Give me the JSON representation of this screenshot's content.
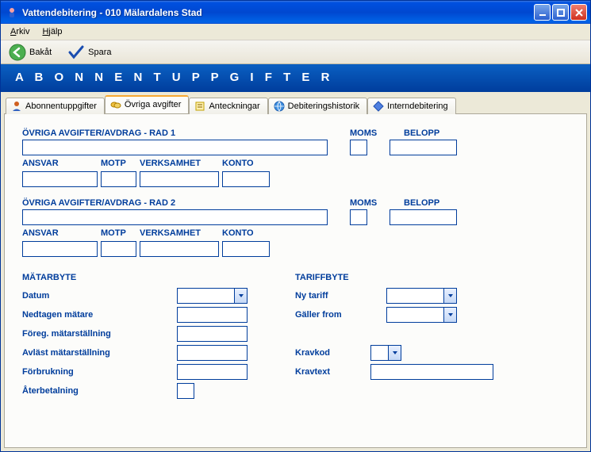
{
  "window": {
    "title": "Vattendebitering  -  010 Mälardalens Stad"
  },
  "menu": {
    "arkiv": "Arkiv",
    "arkiv_ul": "A",
    "arkiv_rest": "rkiv",
    "hjalp": "Hjälp",
    "hjalp_ul": "H",
    "hjalp_rest": "jälp"
  },
  "toolbar": {
    "bakat": "Bakåt",
    "spara": "Spara"
  },
  "header": "A B O N N E N T U P P G I F T E R",
  "tabs": {
    "t1": "Abonnentuppgifter",
    "t2": "Övriga avgifter",
    "t3": "Anteckningar",
    "t4": "Debiteringshistorik",
    "t5": "Interndebitering"
  },
  "labels": {
    "row1": "ÖVRIGA AVGIFTER/AVDRAG - RAD 1",
    "row2": "ÖVRIGA AVGIFTER/AVDRAG - RAD 2",
    "moms": "MOMS",
    "belopp": "BELOPP",
    "ansvar": "ANSVAR",
    "motp": "MOTP",
    "verksamhet": "VERKSAMHET",
    "konto": "KONTO",
    "matarbyte": "MÄTARBYTE",
    "tariffbyte": "TARIFFBYTE",
    "datum": "Datum",
    "nedtagen": "Nedtagen  mätare",
    "foreg": "Föreg. mätarställning",
    "avlast": "Avläst mätarställning",
    "forbrukning": "Förbrukning",
    "aterbetalning": "Återbetalning",
    "nytariff": "Ny tariff",
    "gallerfrom": "Gäller from",
    "kravkod": "Kravkod",
    "kravtext": "Kravtext"
  },
  "values": {
    "row1_desc": "",
    "row1_moms": "",
    "row1_belopp": "",
    "row1_ansvar": "",
    "row1_motp": "",
    "row1_verksamhet": "",
    "row1_konto": "",
    "row2_desc": "",
    "row2_moms": "",
    "row2_belopp": "",
    "row2_ansvar": "",
    "row2_motp": "",
    "row2_verksamhet": "",
    "row2_konto": "",
    "datum": "",
    "nedtagen": "",
    "foreg": "",
    "avlast": "",
    "forbrukning": "",
    "aterbetalning": "",
    "nytariff": "",
    "gallerfrom": "",
    "kravkod": "",
    "kravtext": ""
  }
}
